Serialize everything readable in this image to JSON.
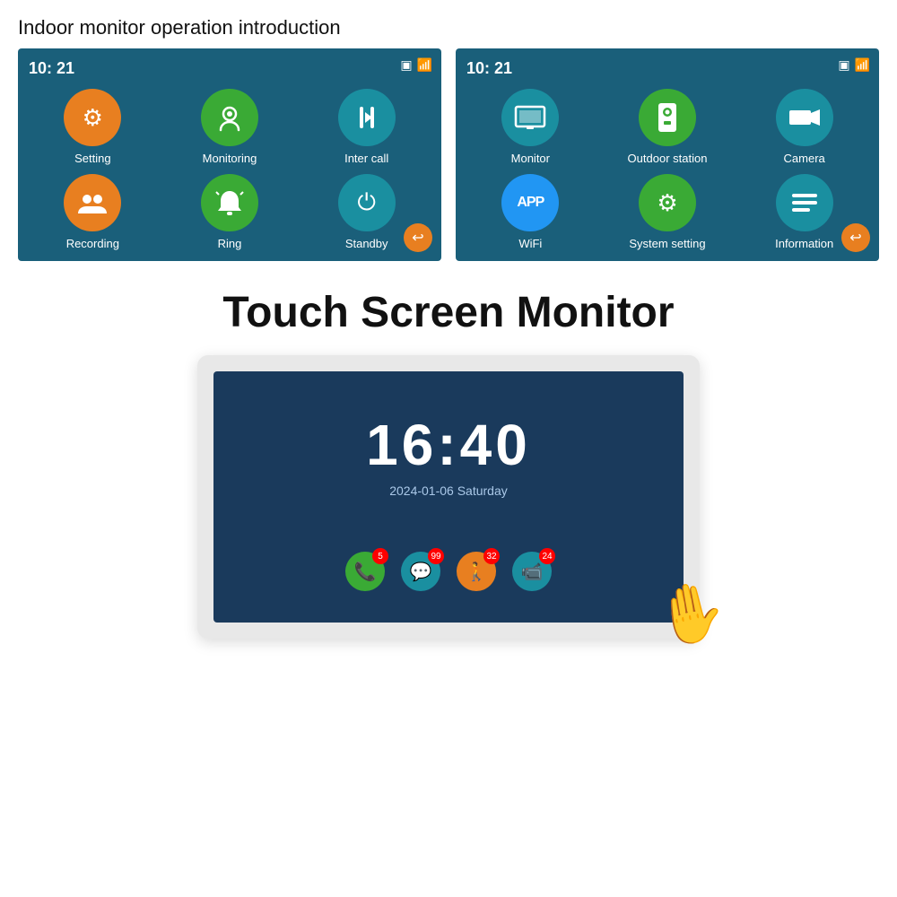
{
  "page": {
    "title": "Indoor monitor operation introduction"
  },
  "screen1": {
    "time": "10: 21",
    "icons": [
      {
        "label": "Setting",
        "color": "orange",
        "symbol": "⚙"
      },
      {
        "label": "Monitoring",
        "color": "green",
        "symbol": "📷"
      },
      {
        "label": "Inter call",
        "color": "teal",
        "symbol": "⇅"
      },
      {
        "label": "Recording",
        "color": "orange",
        "symbol": "👥"
      },
      {
        "label": "Ring",
        "color": "green",
        "symbol": "🔔"
      },
      {
        "label": "Standby",
        "color": "teal",
        "symbol": "⏻"
      }
    ]
  },
  "screen2": {
    "time": "10: 21",
    "icons": [
      {
        "label": "Monitor",
        "color": "teal",
        "symbol": "🖥"
      },
      {
        "label": "Outdoor station",
        "color": "green",
        "symbol": "📟"
      },
      {
        "label": "Camera",
        "color": "teal",
        "symbol": "📹"
      },
      {
        "label": "WiFi",
        "color": "blue",
        "symbol": "APP"
      },
      {
        "label": "System setting",
        "color": "green",
        "symbol": "⚙"
      },
      {
        "label": "Information",
        "color": "teal",
        "symbol": "≡"
      }
    ]
  },
  "monitor": {
    "title": "Touch Screen Monitor",
    "clock": "16:40",
    "date": "2024-01-06  Saturday",
    "bottom_icons": [
      {
        "color": "green",
        "symbol": "📞",
        "badge": "5"
      },
      {
        "color": "teal",
        "symbol": "💬",
        "badge": "99"
      },
      {
        "color": "orange",
        "symbol": "🚶",
        "badge": "32"
      },
      {
        "color": "teal",
        "symbol": "📹",
        "badge": "24"
      }
    ]
  }
}
